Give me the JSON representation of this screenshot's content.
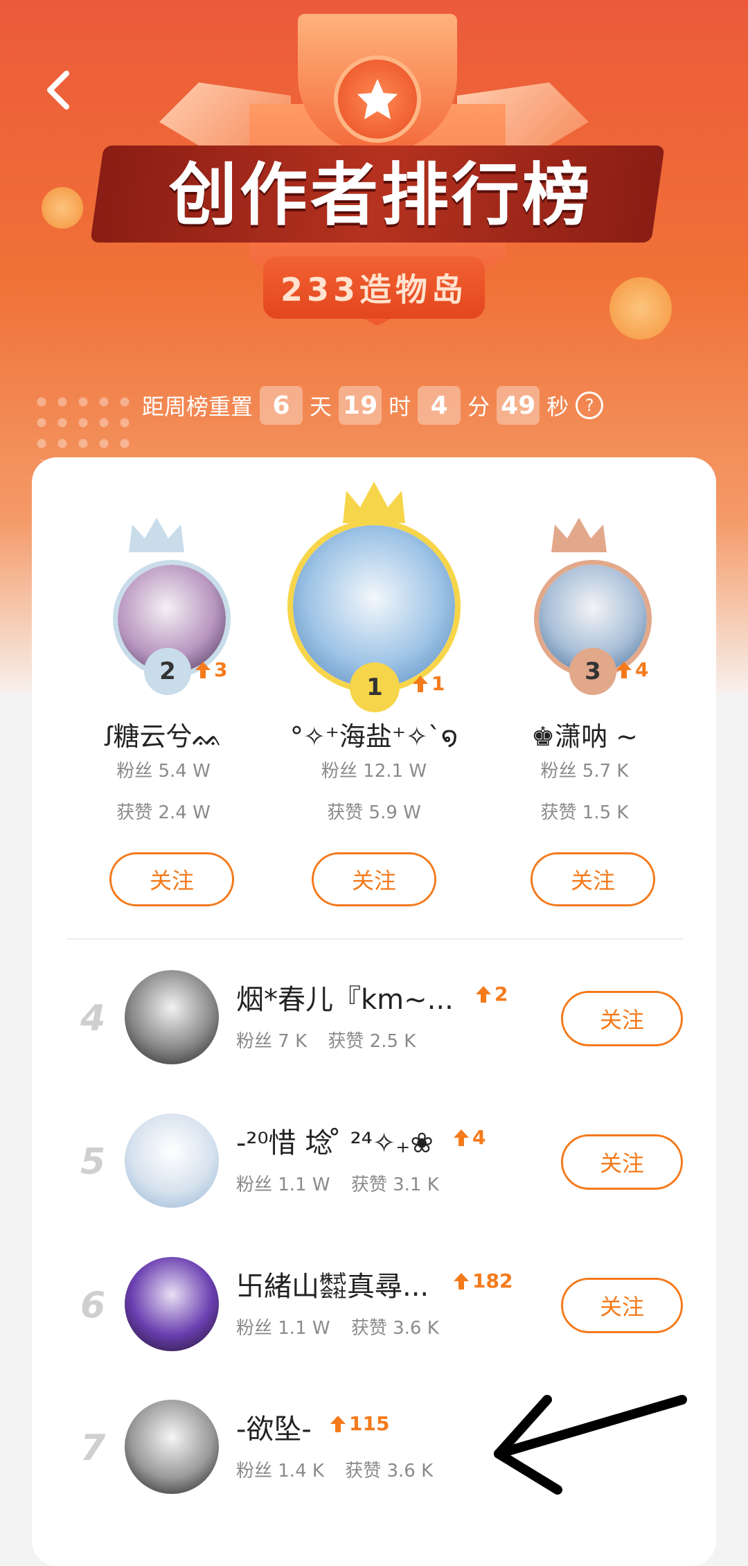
{
  "header": {
    "title": "创作者排行榜",
    "subtitle": "233造物岛"
  },
  "countdown": {
    "label": "距周榜重置",
    "days": "6",
    "days_unit": "天",
    "hours": "19",
    "hours_unit": "时",
    "minutes": "4",
    "minutes_unit": "分",
    "seconds": "49",
    "seconds_unit": "秒",
    "help": "?"
  },
  "podium": [
    {
      "rank": "2",
      "trend": "3",
      "name": "ꭍ糖云兮ᨐ",
      "fans": "粉丝  5.4 W",
      "likes": "获赞 2.4 W",
      "follow": "关注"
    },
    {
      "rank": "1",
      "trend": "1",
      "name": "°✧⁺海盐⁺✧ˋ໑",
      "fans": "粉丝  12.1 W",
      "likes": "获赞 5.9 W",
      "follow": "关注"
    },
    {
      "rank": "3",
      "trend": "4",
      "name": "♚潇呐 ~",
      "fans": "粉丝  5.7 K",
      "likes": "获赞 1.5 K",
      "follow": "关注"
    }
  ],
  "list": [
    {
      "rank": "4",
      "name": "烟*春儿『km~...",
      "trend": "2",
      "fans": "粉丝 7 K",
      "likes": "获赞 2.5 K",
      "follow": "关注"
    },
    {
      "rank": "5",
      "name": "-²⁰惜 埝 ̊ ²⁴✧₊❀",
      "trend": "4",
      "fans": "粉丝 1.1 W",
      "likes": "获赞 3.1 K",
      "follow": "关注"
    },
    {
      "rank": "6",
      "name": "卐緒山㍿真尋...",
      "trend": "182",
      "fans": "粉丝 1.1 W",
      "likes": "获赞 3.6 K",
      "follow": "关注"
    },
    {
      "rank": "7",
      "name": "-欲坠-",
      "trend": "115",
      "fans": "粉丝 1.4 K",
      "likes": "获赞 3.6 K",
      "follow": ""
    }
  ],
  "colors": {
    "accent": "#f47a1c",
    "hero_top": "#ec5a3a",
    "gold": "#f7d54a",
    "silver": "#c8dcea",
    "bronze": "#e2a88a"
  },
  "icons": {
    "back": "chevron-left-icon",
    "trend": "arrow-up-icon",
    "crown": "crown-icon",
    "trophy_star": "star-icon"
  }
}
